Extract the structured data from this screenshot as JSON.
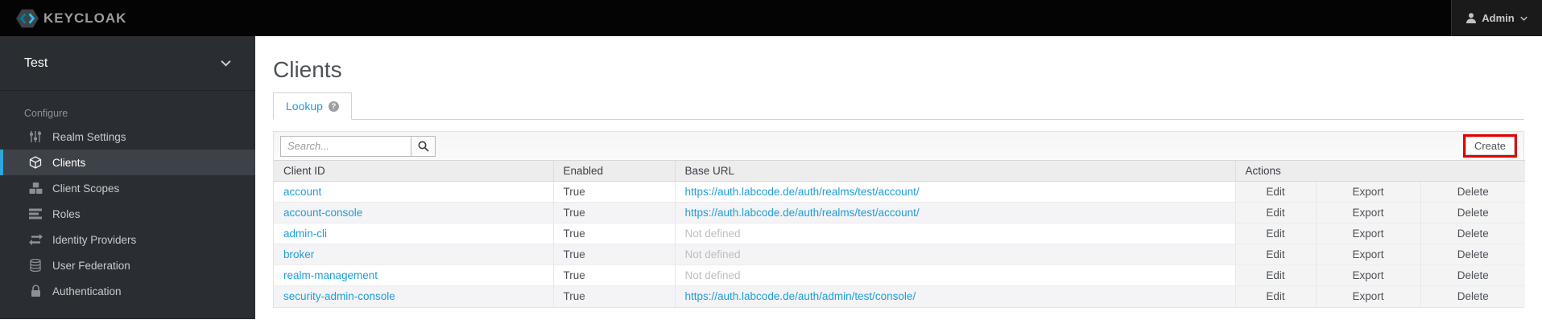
{
  "header": {
    "logo_text": "KEYCLOAK",
    "user_label": "Admin"
  },
  "sidebar": {
    "realm": "Test",
    "section_label": "Configure",
    "items": [
      {
        "label": "Realm Settings",
        "icon": "sliders-icon",
        "active": false
      },
      {
        "label": "Clients",
        "icon": "cube-icon",
        "active": true
      },
      {
        "label": "Client Scopes",
        "icon": "cubes-icon",
        "active": false
      },
      {
        "label": "Roles",
        "icon": "list-icon",
        "active": false
      },
      {
        "label": "Identity Providers",
        "icon": "exchange-icon",
        "active": false
      },
      {
        "label": "User Federation",
        "icon": "database-icon",
        "active": false
      },
      {
        "label": "Authentication",
        "icon": "lock-icon",
        "active": false
      }
    ]
  },
  "main": {
    "title": "Clients",
    "tab": {
      "label": "Lookup",
      "help_glyph": "?"
    },
    "search": {
      "placeholder": "Search...",
      "value": ""
    },
    "create_label": "Create",
    "table": {
      "columns": [
        "Client ID",
        "Enabled",
        "Base URL",
        "Actions"
      ],
      "action_labels": [
        "Edit",
        "Export",
        "Delete"
      ],
      "rows": [
        {
          "client_id": "account",
          "enabled": "True",
          "base_url": "https://auth.labcode.de/auth/realms/test/account/",
          "base_url_defined": true
        },
        {
          "client_id": "account-console",
          "enabled": "True",
          "base_url": "https://auth.labcode.de/auth/realms/test/account/",
          "base_url_defined": true
        },
        {
          "client_id": "admin-cli",
          "enabled": "True",
          "base_url": "Not defined",
          "base_url_defined": false
        },
        {
          "client_id": "broker",
          "enabled": "True",
          "base_url": "Not defined",
          "base_url_defined": false
        },
        {
          "client_id": "realm-management",
          "enabled": "True",
          "base_url": "Not defined",
          "base_url_defined": false
        },
        {
          "client_id": "security-admin-console",
          "enabled": "True",
          "base_url": "https://auth.labcode.de/auth/admin/test/console/",
          "base_url_defined": true
        }
      ]
    }
  },
  "colors": {
    "accent_blue": "#1e9ed9",
    "link_blue": "#1e9ed9",
    "annotation_red": "#e60000",
    "sidebar_bg": "#2a2e33",
    "sidebar_active_border": "#2ca8dd",
    "header_bg": "#040404"
  }
}
